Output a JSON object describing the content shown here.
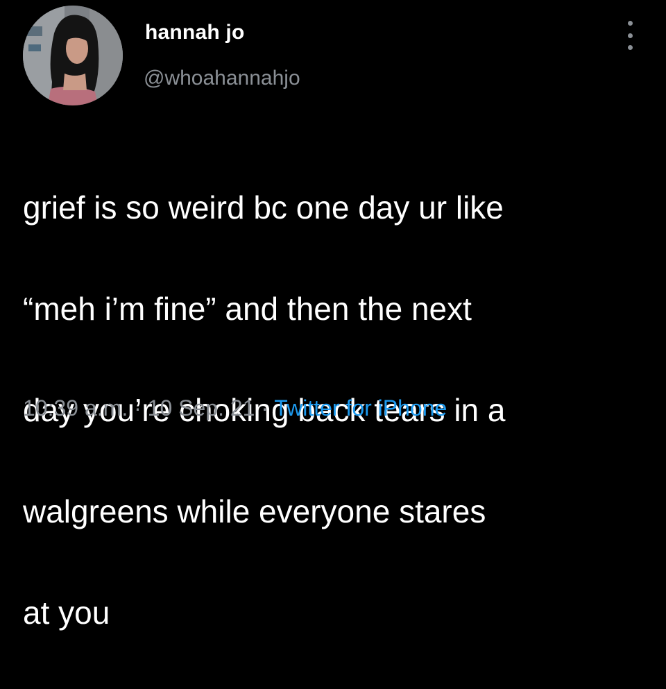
{
  "tweet": {
    "author": {
      "display_name": "hannah jo",
      "handle": "@whoahannahjo",
      "avatar_icon": "profile-photo"
    },
    "more_icon": "more-dots-vertical-icon",
    "text_lines": [
      "grief is so weird bc one day ur like",
      "“meh i’m fine” and then the next",
      "day you’re choking back tears in a",
      "walgreens while everyone stares",
      "at you"
    ],
    "meta": {
      "time": "10:39 a.m.",
      "separator": "·",
      "date": "10 Sep. 21",
      "source": "Twitter for iPhone"
    }
  },
  "colors": {
    "background": "#000000",
    "text_primary": "#ffffff",
    "text_secondary": "#8b9096",
    "link_accent": "#1d9bf0"
  }
}
